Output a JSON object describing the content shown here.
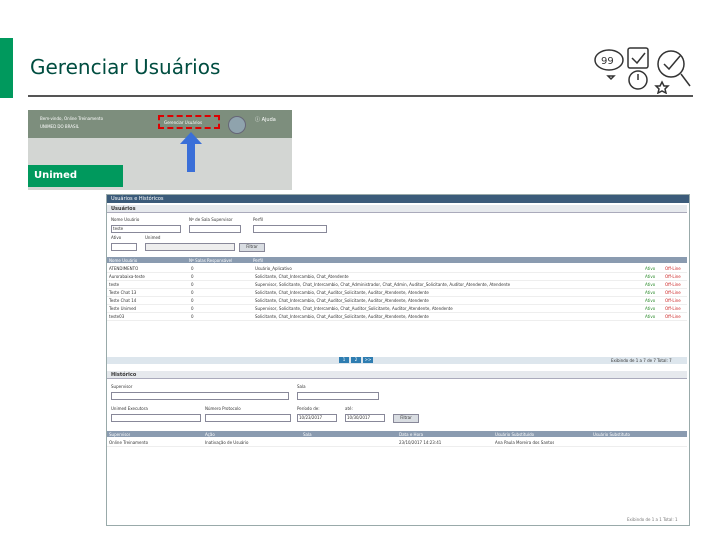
{
  "slide": {
    "title": "Gerenciar Usuários"
  },
  "top_screenshot": {
    "header_line1": "Bem-vindo, Online Treinamento",
    "header_line2": "UNIMED DO BRASIL",
    "gerenciar_btn": "Gerenciar Usuários",
    "sair_btn": "Sair",
    "help": "Ajuda",
    "brand": "Unimed"
  },
  "app": {
    "window_title": "Usuários e Históricos",
    "users_section": "Usuários",
    "labels": {
      "nome": "Nome Usuário",
      "senha": "Nº de Sala Supervisor",
      "perfil": "Perfil",
      "ativo": "Ativo",
      "unimed": "Unimed"
    },
    "nome_value": "teste",
    "filtrar": "Filtrar",
    "columns": [
      "Nome Usuário",
      "Nº Salas Responsável",
      "Perfil"
    ],
    "rows": [
      {
        "name": "ATENDIMENTO",
        "n": "0",
        "perfil": "Usuário_Aplicativo",
        "ativo": "Ativo",
        "status": "Off-Line"
      },
      {
        "name": "Aurorabaixa-teste",
        "n": "0",
        "perfil": "Solicitante, Chat_Intercambio, Chat_Atendente",
        "ativo": "Ativo",
        "status": "Off-Line"
      },
      {
        "name": "teste",
        "n": "0",
        "perfil": "Supervisor, Solicitante, Chat_Intercambio, Chat_Administrador, Chat_Admin, Auditor_Solicitante, Auditor_Atendente, Atendente",
        "ativo": "Ativo",
        "status": "Off-Line"
      },
      {
        "name": "Teste Chat 13",
        "n": "0",
        "perfil": "Solicitante, Chat_Intercambio, Chat_Auditor_Solicitante, Auditor_Atendente, Atendente",
        "ativo": "Ativo",
        "status": "Off-Line"
      },
      {
        "name": "Teste Chat 14",
        "n": "0",
        "perfil": "Solicitante, Chat_Intercambio, Chat_Auditor_Solicitante, Auditor_Atendente, Atendente",
        "ativo": "Ativo",
        "status": "Off-Line"
      },
      {
        "name": "Teste Unimed",
        "n": "0",
        "perfil": "Supervisor, Solicitante, Chat_Intercambio, Chat_Auditor_Solicitante, Auditor_Atendente, Atendente",
        "ativo": "Ativo",
        "status": "Off-Line"
      },
      {
        "name": "teste03",
        "n": "0",
        "perfil": "Solicitante, Chat_Intercambio, Chat_Auditor_Solicitante, Auditor_Atendente, Atendente",
        "ativo": "Ativo",
        "status": "Off-Line"
      }
    ],
    "pages": [
      "1",
      "2",
      ">>"
    ],
    "pager_info": "Exibindo de 1 a 7 de 7 Total: 7",
    "history_section": "Histórico",
    "hist_labels": {
      "supervisor": "Supervisor",
      "sala": "Sala",
      "unimed": "Unimed Executora",
      "protocolo": "Número Protocolo",
      "periodo": "Período de:",
      "ate": "até:"
    },
    "date_from": "10/23/2017",
    "date_to": "10/30/2017",
    "hist_columns": [
      "Supervisor",
      "Ação",
      "Sala",
      "Data e Hora",
      "Usuário Substituído",
      "Usuário Substituto"
    ],
    "hist_row": [
      "Online Treinamento",
      "Inativação de Usuário",
      "",
      "23/10/2017 14:23:41",
      "Ana Paula Moreira dos Santos",
      ""
    ],
    "footer": "Exibindo de 1 a 1 Total: 1"
  }
}
